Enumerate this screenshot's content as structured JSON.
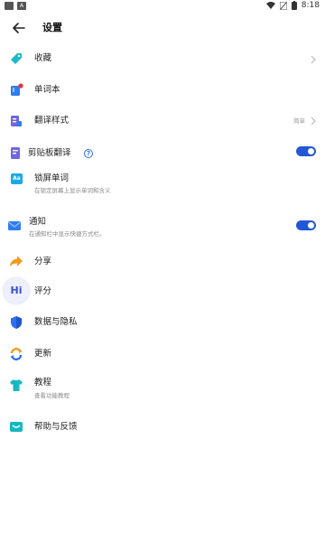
{
  "status": {
    "left_icons": [
      "sim-badge",
      "A"
    ],
    "time": "8:18"
  },
  "header": {
    "title": "设置"
  },
  "items": {
    "favorites": {
      "label": "收藏",
      "icon": "tag-icon"
    },
    "wordbook": {
      "label": "单词本",
      "icon": "book-icon"
    },
    "translate_style": {
      "label": "翻译样式",
      "value": "简单",
      "icon": "style-icon"
    },
    "clipboard": {
      "label": "剪贴板翻译",
      "icon": "clipboard-icon",
      "toggle": "on"
    },
    "lockscreen": {
      "label": "锁屏单词",
      "sub": "在锁定屏幕上显示单词和含义",
      "icon": "aa-icon",
      "badge": "Aa"
    },
    "notification": {
      "label": "通知",
      "sub": "在通知栏中显示快捷方式栏。",
      "icon": "mail-icon",
      "toggle": "on"
    },
    "share": {
      "label": "分享",
      "icon": "share-arrow-icon"
    },
    "rate": {
      "label": "评分",
      "icon": "hi-badge-icon",
      "badge": "Hi"
    },
    "privacy": {
      "label": "数据与隐私",
      "icon": "shield-icon"
    },
    "update": {
      "label": "更新",
      "icon": "refresh-icon"
    },
    "tutorial": {
      "label": "教程",
      "sub": "查看功能教程",
      "icon": "shirt-icon"
    },
    "help": {
      "label": "帮助与反馈",
      "icon": "chat-icon"
    }
  },
  "colors": {
    "accent": "#2457d6",
    "teal": "#1fb8c9",
    "orange": "#f39a1c",
    "purple": "#6f66e0"
  }
}
